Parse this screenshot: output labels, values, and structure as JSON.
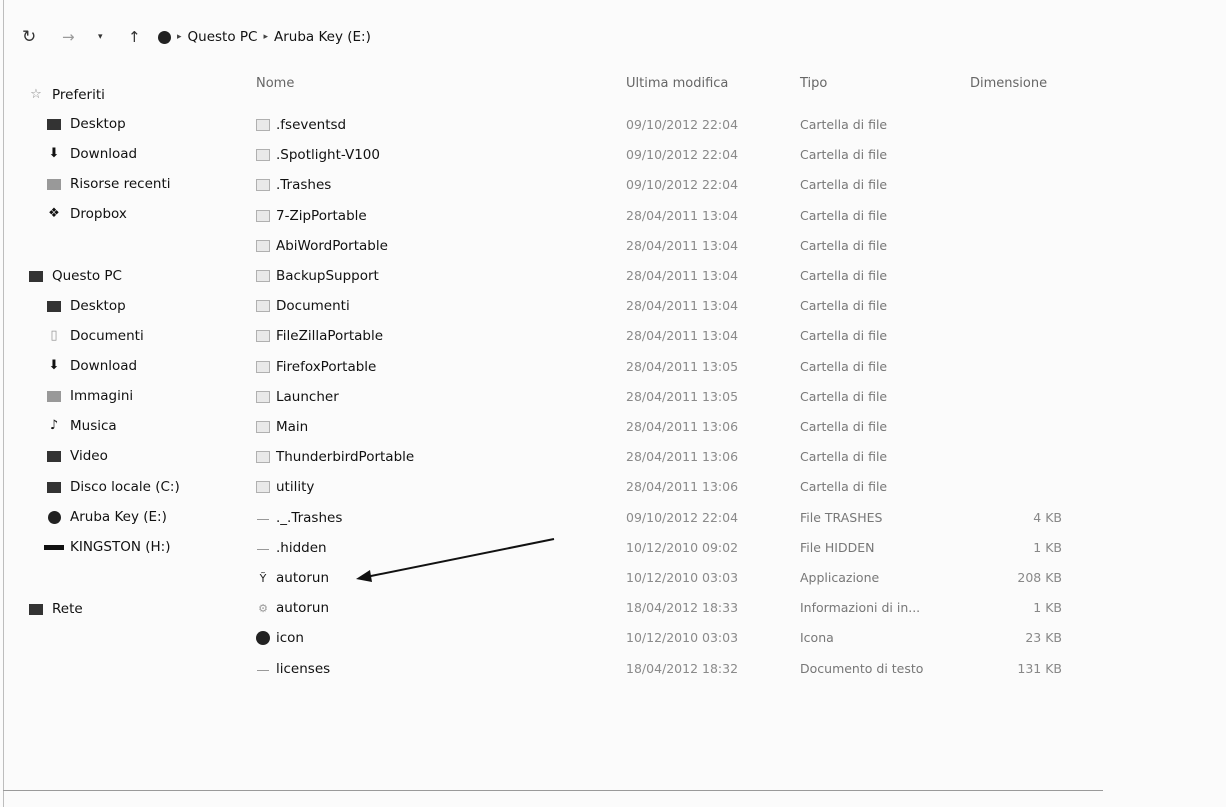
{
  "address_bar": {
    "nav_back": "↻",
    "nav_forward": "→",
    "nav_recent": "▾",
    "nav_up": "↑",
    "path": [
      "Questo PC",
      "Aruba Key (E:)"
    ],
    "separator": "▸"
  },
  "sidebar": {
    "favorites": {
      "label": "Preferiti",
      "items": [
        {
          "label": "Desktop",
          "icon": "desktop-icon"
        },
        {
          "label": "Download",
          "icon": "download-icon"
        },
        {
          "label": "Risorse recenti",
          "icon": "recent-places-icon"
        },
        {
          "label": "Dropbox",
          "icon": "dropbox-icon"
        }
      ]
    },
    "this_pc": {
      "label": "Questo PC",
      "items": [
        {
          "label": "Desktop",
          "icon": "desktop-icon"
        },
        {
          "label": "Documenti",
          "icon": "documents-icon"
        },
        {
          "label": "Download",
          "icon": "download-icon"
        },
        {
          "label": "Immagini",
          "icon": "pictures-icon"
        },
        {
          "label": "Musica",
          "icon": "music-icon"
        },
        {
          "label": "Video",
          "icon": "video-icon"
        },
        {
          "label": "Disco locale (C:)",
          "icon": "local-disk-icon"
        },
        {
          "label": "Aruba Key (E:)",
          "icon": "usb-key-icon"
        },
        {
          "label": "KINGSTON (H:)",
          "icon": "removable-drive-icon"
        }
      ]
    },
    "network": {
      "label": "Rete",
      "icon": "network-icon"
    }
  },
  "columns": {
    "name": "Nome",
    "modified": "Ultima modifica",
    "type": "Tipo",
    "size": "Dimensione"
  },
  "files": [
    {
      "name": ".fseventsd",
      "date": "09/10/2012 22:04",
      "type": "Cartella di file",
      "size": "",
      "icon": "folder-icon"
    },
    {
      "name": ".Spotlight-V100",
      "date": "09/10/2012 22:04",
      "type": "Cartella di file",
      "size": "",
      "icon": "folder-icon"
    },
    {
      "name": ".Trashes",
      "date": "09/10/2012 22:04",
      "type": "Cartella di file",
      "size": "",
      "icon": "folder-icon"
    },
    {
      "name": "7-ZipPortable",
      "date": "28/04/2011 13:04",
      "type": "Cartella di file",
      "size": "",
      "icon": "folder-icon"
    },
    {
      "name": "AbiWordPortable",
      "date": "28/04/2011 13:04",
      "type": "Cartella di file",
      "size": "",
      "icon": "folder-icon"
    },
    {
      "name": "BackupSupport",
      "date": "28/04/2011 13:04",
      "type": "Cartella di file",
      "size": "",
      "icon": "folder-icon"
    },
    {
      "name": "Documenti",
      "date": "28/04/2011 13:04",
      "type": "Cartella di file",
      "size": "",
      "icon": "folder-icon"
    },
    {
      "name": "FileZillaPortable",
      "date": "28/04/2011 13:04",
      "type": "Cartella di file",
      "size": "",
      "icon": "folder-icon"
    },
    {
      "name": "FirefoxPortable",
      "date": "28/04/2011 13:05",
      "type": "Cartella di file",
      "size": "",
      "icon": "folder-icon"
    },
    {
      "name": "Launcher",
      "date": "28/04/2011 13:05",
      "type": "Cartella di file",
      "size": "",
      "icon": "folder-icon"
    },
    {
      "name": "Main",
      "date": "28/04/2011 13:06",
      "type": "Cartella di file",
      "size": "",
      "icon": "folder-icon"
    },
    {
      "name": "ThunderbirdPortable",
      "date": "28/04/2011 13:06",
      "type": "Cartella di file",
      "size": "",
      "icon": "folder-icon"
    },
    {
      "name": "utility",
      "date": "28/04/2011 13:06",
      "type": "Cartella di file",
      "size": "",
      "icon": "folder-icon"
    },
    {
      "name": "._.Trashes",
      "date": "09/10/2012 22:04",
      "type": "File TRASHES",
      "size": "4 KB",
      "icon": "file-icon"
    },
    {
      "name": ".hidden",
      "date": "10/12/2010 09:02",
      "type": "File HIDDEN",
      "size": "1 KB",
      "icon": "file-icon"
    },
    {
      "name": "autorun",
      "date": "10/12/2010 03:03",
      "type": "Applicazione",
      "size": "208 KB",
      "icon": "application-icon"
    },
    {
      "name": "autorun",
      "date": "18/04/2012 18:33",
      "type": "Informazioni di in...",
      "size": "1 KB",
      "icon": "setup-info-icon"
    },
    {
      "name": "icon",
      "date": "10/12/2010 03:03",
      "type": "Icona",
      "size": "23 KB",
      "icon": "icon-file-icon"
    },
    {
      "name": "licenses",
      "date": "18/04/2012 18:32",
      "type": "Documento di testo",
      "size": "131 KB",
      "icon": "text-document-icon"
    }
  ],
  "colors": {
    "background": "#fbfbfb",
    "text": "#111111",
    "muted_text": "#8a8a8a",
    "annotation_arrow": "#111111"
  }
}
